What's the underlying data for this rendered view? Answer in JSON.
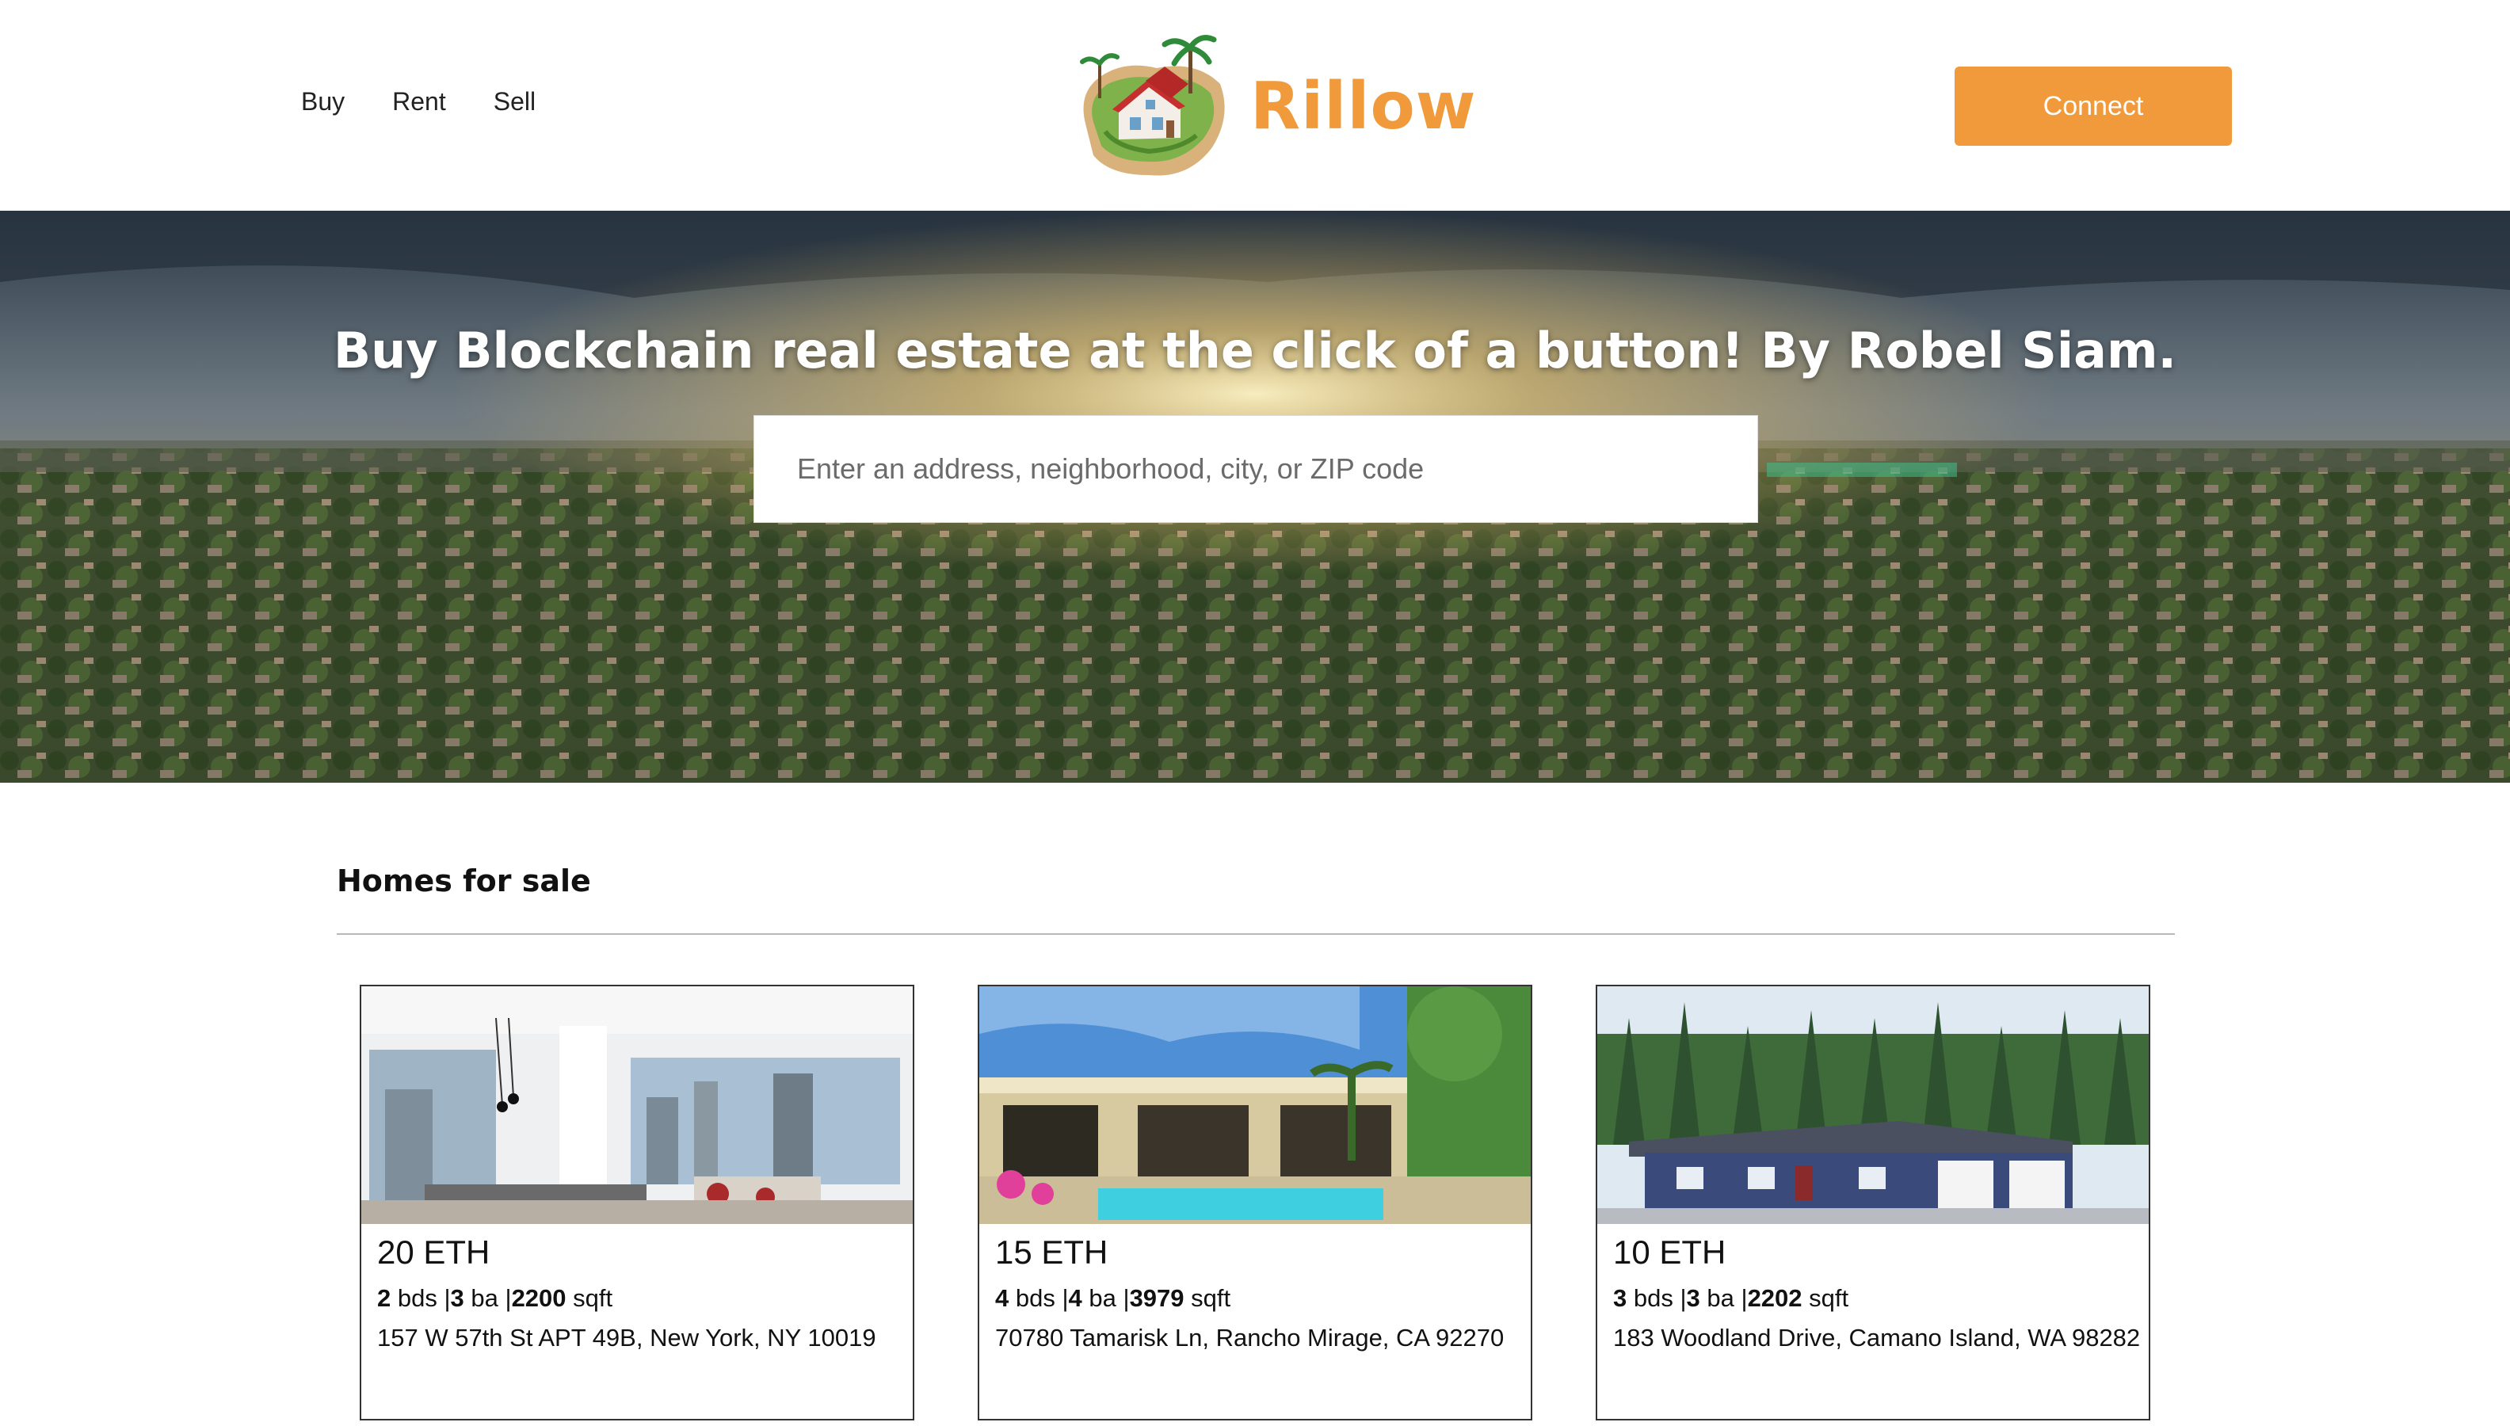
{
  "header": {
    "nav": [
      "Buy",
      "Rent",
      "Sell"
    ],
    "brand": "Rillow",
    "connect_label": "Connect"
  },
  "hero": {
    "title": "Buy Blockchain real estate at the click of a button! By Robel Siam.",
    "search_placeholder": "Enter an address, neighborhood, city, or ZIP code"
  },
  "listings": {
    "section_title": "Homes for sale",
    "items": [
      {
        "price": "20 ETH",
        "beds": "2",
        "baths": "3",
        "sqft": "2200",
        "beds_unit": "bds",
        "baths_unit": "ba",
        "sqft_unit": "sqft",
        "address": "157 W 57th St APT 49B, New York, NY 10019"
      },
      {
        "price": "15 ETH",
        "beds": "4",
        "baths": "4",
        "sqft": "3979",
        "beds_unit": "bds",
        "baths_unit": "ba",
        "sqft_unit": "sqft",
        "address": "70780 Tamarisk Ln, Rancho Mirage, CA 92270"
      },
      {
        "price": "10 ETH",
        "beds": "3",
        "baths": "3",
        "sqft": "2202",
        "beds_unit": "bds",
        "baths_unit": "ba",
        "sqft_unit": "sqft",
        "address": "183 Woodland Drive, Camano Island, WA 98282"
      }
    ]
  },
  "colors": {
    "accent": "#f09a3b",
    "text": "#111111",
    "divider": "#b8b8b8"
  }
}
